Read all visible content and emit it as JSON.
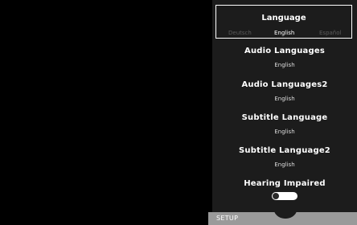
{
  "language": {
    "title": "Language",
    "options": [
      "Deutsch",
      "English",
      "Español"
    ],
    "selected": "English"
  },
  "settings": [
    {
      "title": "Audio Languages",
      "value": "English"
    },
    {
      "title": "Audio Languages2",
      "value": "English"
    },
    {
      "title": "Subtitle Language",
      "value": "English"
    },
    {
      "title": "Subtitle Language2",
      "value": "English"
    }
  ],
  "hearing_impaired": {
    "title": "Hearing Impaired",
    "enabled": false
  },
  "bottom_bar": {
    "label": "SETUP"
  },
  "colors": {
    "panel": "#1c1c1c",
    "bar": "#9a9a9a",
    "text": "#ffffff",
    "inactive": "#5a5a5a"
  }
}
